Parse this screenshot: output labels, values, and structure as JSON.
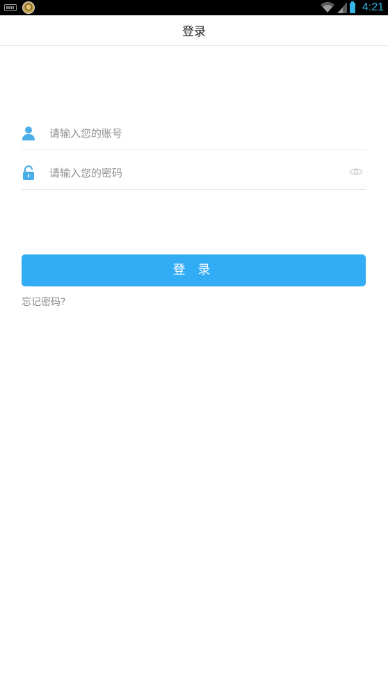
{
  "statusbar": {
    "time": "4:21",
    "accent_color": "#33b5e5"
  },
  "header": {
    "title": "登录"
  },
  "form": {
    "account": {
      "placeholder": "请输入您的账号",
      "value": "",
      "icon": "user-icon"
    },
    "password": {
      "placeholder": "请输入您的密码",
      "value": "",
      "icon": "unlock-icon",
      "toggle_icon": "eye-icon"
    },
    "login_label": "登 录",
    "forgot_label": "忘记密码?",
    "button_color": "#32adf5"
  }
}
